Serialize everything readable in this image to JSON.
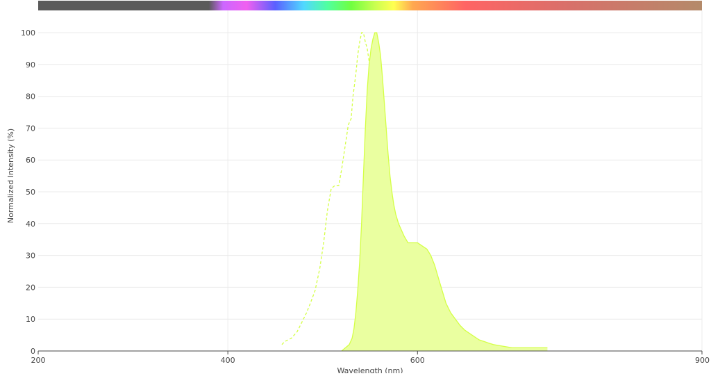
{
  "chart_data": {
    "type": "area",
    "xlabel": "Wavelength (nm)",
    "ylabel": "Normalized Intensity (%)",
    "xlim": [
      200,
      900
    ],
    "ylim": [
      0,
      100
    ],
    "x_ticks": [
      "200",
      "400",
      "600",
      "900"
    ],
    "x_tick_values": [
      200,
      400,
      600,
      900
    ],
    "y_ticks": [
      "0",
      "10",
      "20",
      "30",
      "40",
      "50",
      "60",
      "70",
      "80",
      "90",
      "100"
    ],
    "y_tick_values": [
      0,
      10,
      20,
      30,
      40,
      50,
      60,
      70,
      80,
      90,
      100
    ],
    "grid": true,
    "spectrum_bar": {
      "range_nm": [
        200,
        900
      ],
      "stops": [
        {
          "nm": 200,
          "color": "#5a5a5a"
        },
        {
          "nm": 380,
          "color": "#5a5a5a"
        },
        {
          "nm": 395,
          "color": "#cc66ff"
        },
        {
          "nm": 420,
          "color": "#f060f0"
        },
        {
          "nm": 450,
          "color": "#5a60ff"
        },
        {
          "nm": 480,
          "color": "#50d8ff"
        },
        {
          "nm": 505,
          "color": "#50ffa0"
        },
        {
          "nm": 530,
          "color": "#70ff40"
        },
        {
          "nm": 555,
          "color": "#c8ff50"
        },
        {
          "nm": 575,
          "color": "#ffff50"
        },
        {
          "nm": 595,
          "color": "#ffa850"
        },
        {
          "nm": 650,
          "color": "#ff6464"
        },
        {
          "nm": 760,
          "color": "#d8706a"
        },
        {
          "nm": 900,
          "color": "#b48a6a"
        }
      ]
    },
    "series": [
      {
        "style": "dashed",
        "filled": false,
        "color": "#d4ff46",
        "x": [
          457,
          460,
          467,
          473,
          478,
          483,
          487,
          492,
          497,
          501,
          505,
          509,
          513,
          517,
          520,
          523,
          525,
          527,
          530,
          532,
          535,
          537,
          539,
          541,
          543,
          545,
          547,
          549,
          551,
          553,
          555,
          557,
          559,
          561,
          563,
          565,
          567,
          569,
          571,
          573,
          575,
          578,
          583,
          590,
          596
        ],
        "y": [
          2,
          3,
          4,
          6,
          9,
          12,
          15,
          19,
          26,
          34,
          44,
          51,
          52,
          52,
          57,
          63,
          67,
          71,
          73,
          80,
          87,
          93,
          97,
          100,
          100,
          97,
          95,
          91,
          84,
          73,
          61,
          48,
          36,
          26,
          20,
          15,
          11,
          7,
          4,
          2,
          1,
          0.5,
          0.2,
          0.1,
          0
        ]
      },
      {
        "style": "solid",
        "filled": true,
        "color": "#d4ff46",
        "fill": "#eaffa0",
        "x": [
          520,
          524,
          528,
          531,
          533,
          535,
          537,
          539,
          541,
          543,
          545,
          547,
          549,
          551,
          553,
          555,
          557,
          559,
          561,
          563,
          565,
          567,
          569,
          571,
          573,
          575,
          577,
          580,
          583,
          586,
          590,
          595,
          600,
          605,
          610,
          614,
          618,
          622,
          626,
          630,
          635,
          640,
          645,
          650,
          655,
          660,
          665,
          670,
          675,
          680,
          690,
          700,
          710,
          720,
          730,
          737
        ],
        "y": [
          0,
          1,
          2,
          4,
          7,
          12,
          19,
          28,
          40,
          55,
          70,
          82,
          90,
          95,
          98,
          100,
          100,
          97,
          93,
          86,
          78,
          70,
          62,
          55,
          50,
          46,
          43,
          40,
          38,
          36,
          34,
          34,
          34,
          33,
          32,
          30,
          27,
          23,
          19,
          15,
          12,
          10,
          8,
          6.5,
          5.5,
          4.5,
          3.5,
          3,
          2.5,
          2,
          1.5,
          1,
          1,
          1,
          1,
          1
        ]
      }
    ]
  }
}
